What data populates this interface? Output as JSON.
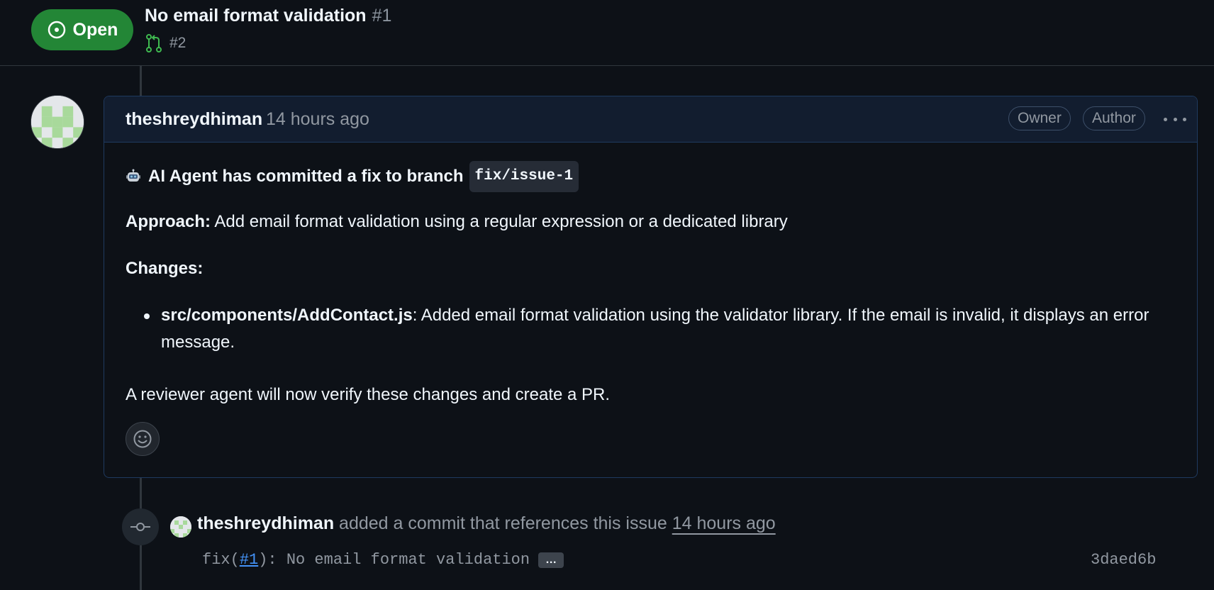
{
  "issue": {
    "state": "Open",
    "title": "No email format validation",
    "number": "#1",
    "linked_pr": "#2"
  },
  "comment": {
    "author": "theshreydhiman",
    "time": "14 hours ago",
    "roles": [
      "Owner",
      "Author"
    ],
    "headline": "AI Agent has committed a fix to branch",
    "branch": "fix/issue-1",
    "approach_label": "Approach:",
    "approach_text": " Add email format validation using a regular expression or a dedicated library",
    "changes_label": "Changes:",
    "change_file": "src/components/AddContact.js",
    "change_text": ": Added email format validation using the validator library. If the email is invalid, it displays an error message.",
    "closing": "A reviewer agent will now verify these changes and create a PR."
  },
  "event": {
    "author": "theshreydhiman",
    "action": " added a commit that references this issue ",
    "time": "14 hours ago",
    "commit_prefix": "fix(",
    "commit_ref": "#1",
    "commit_suffix": "): No email format validation",
    "ellipsis": "…",
    "sha": "3daed6b"
  },
  "colors": {
    "background": "#0d1117",
    "open_green": "#238636",
    "link_blue": "#4493f8",
    "muted": "#9198a1"
  }
}
